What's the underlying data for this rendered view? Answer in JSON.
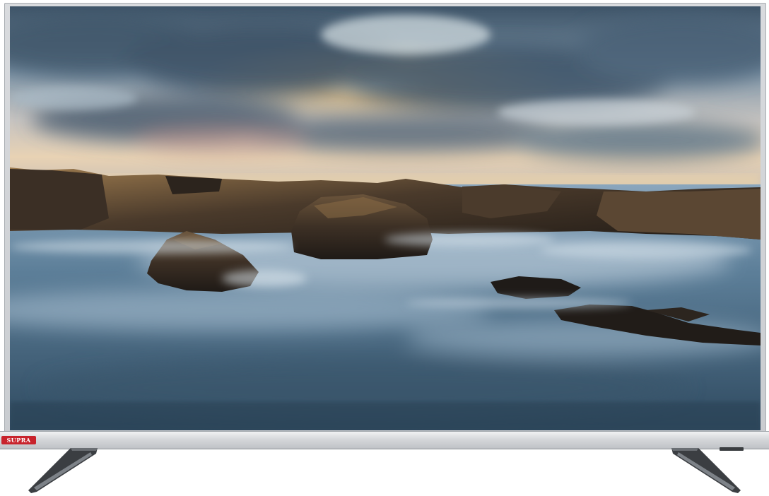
{
  "product": {
    "brand_label": "SUPRA",
    "brand_color": "#c8232c",
    "bezel_color": "#d0d3d7"
  },
  "screen_image": {
    "scene": "seascape-rocks-sunset",
    "sky_color": "#8fa6b8",
    "sun_color": "#f4c77a",
    "water_color": "#4d6b82",
    "rock_color": "#3a2f25"
  }
}
